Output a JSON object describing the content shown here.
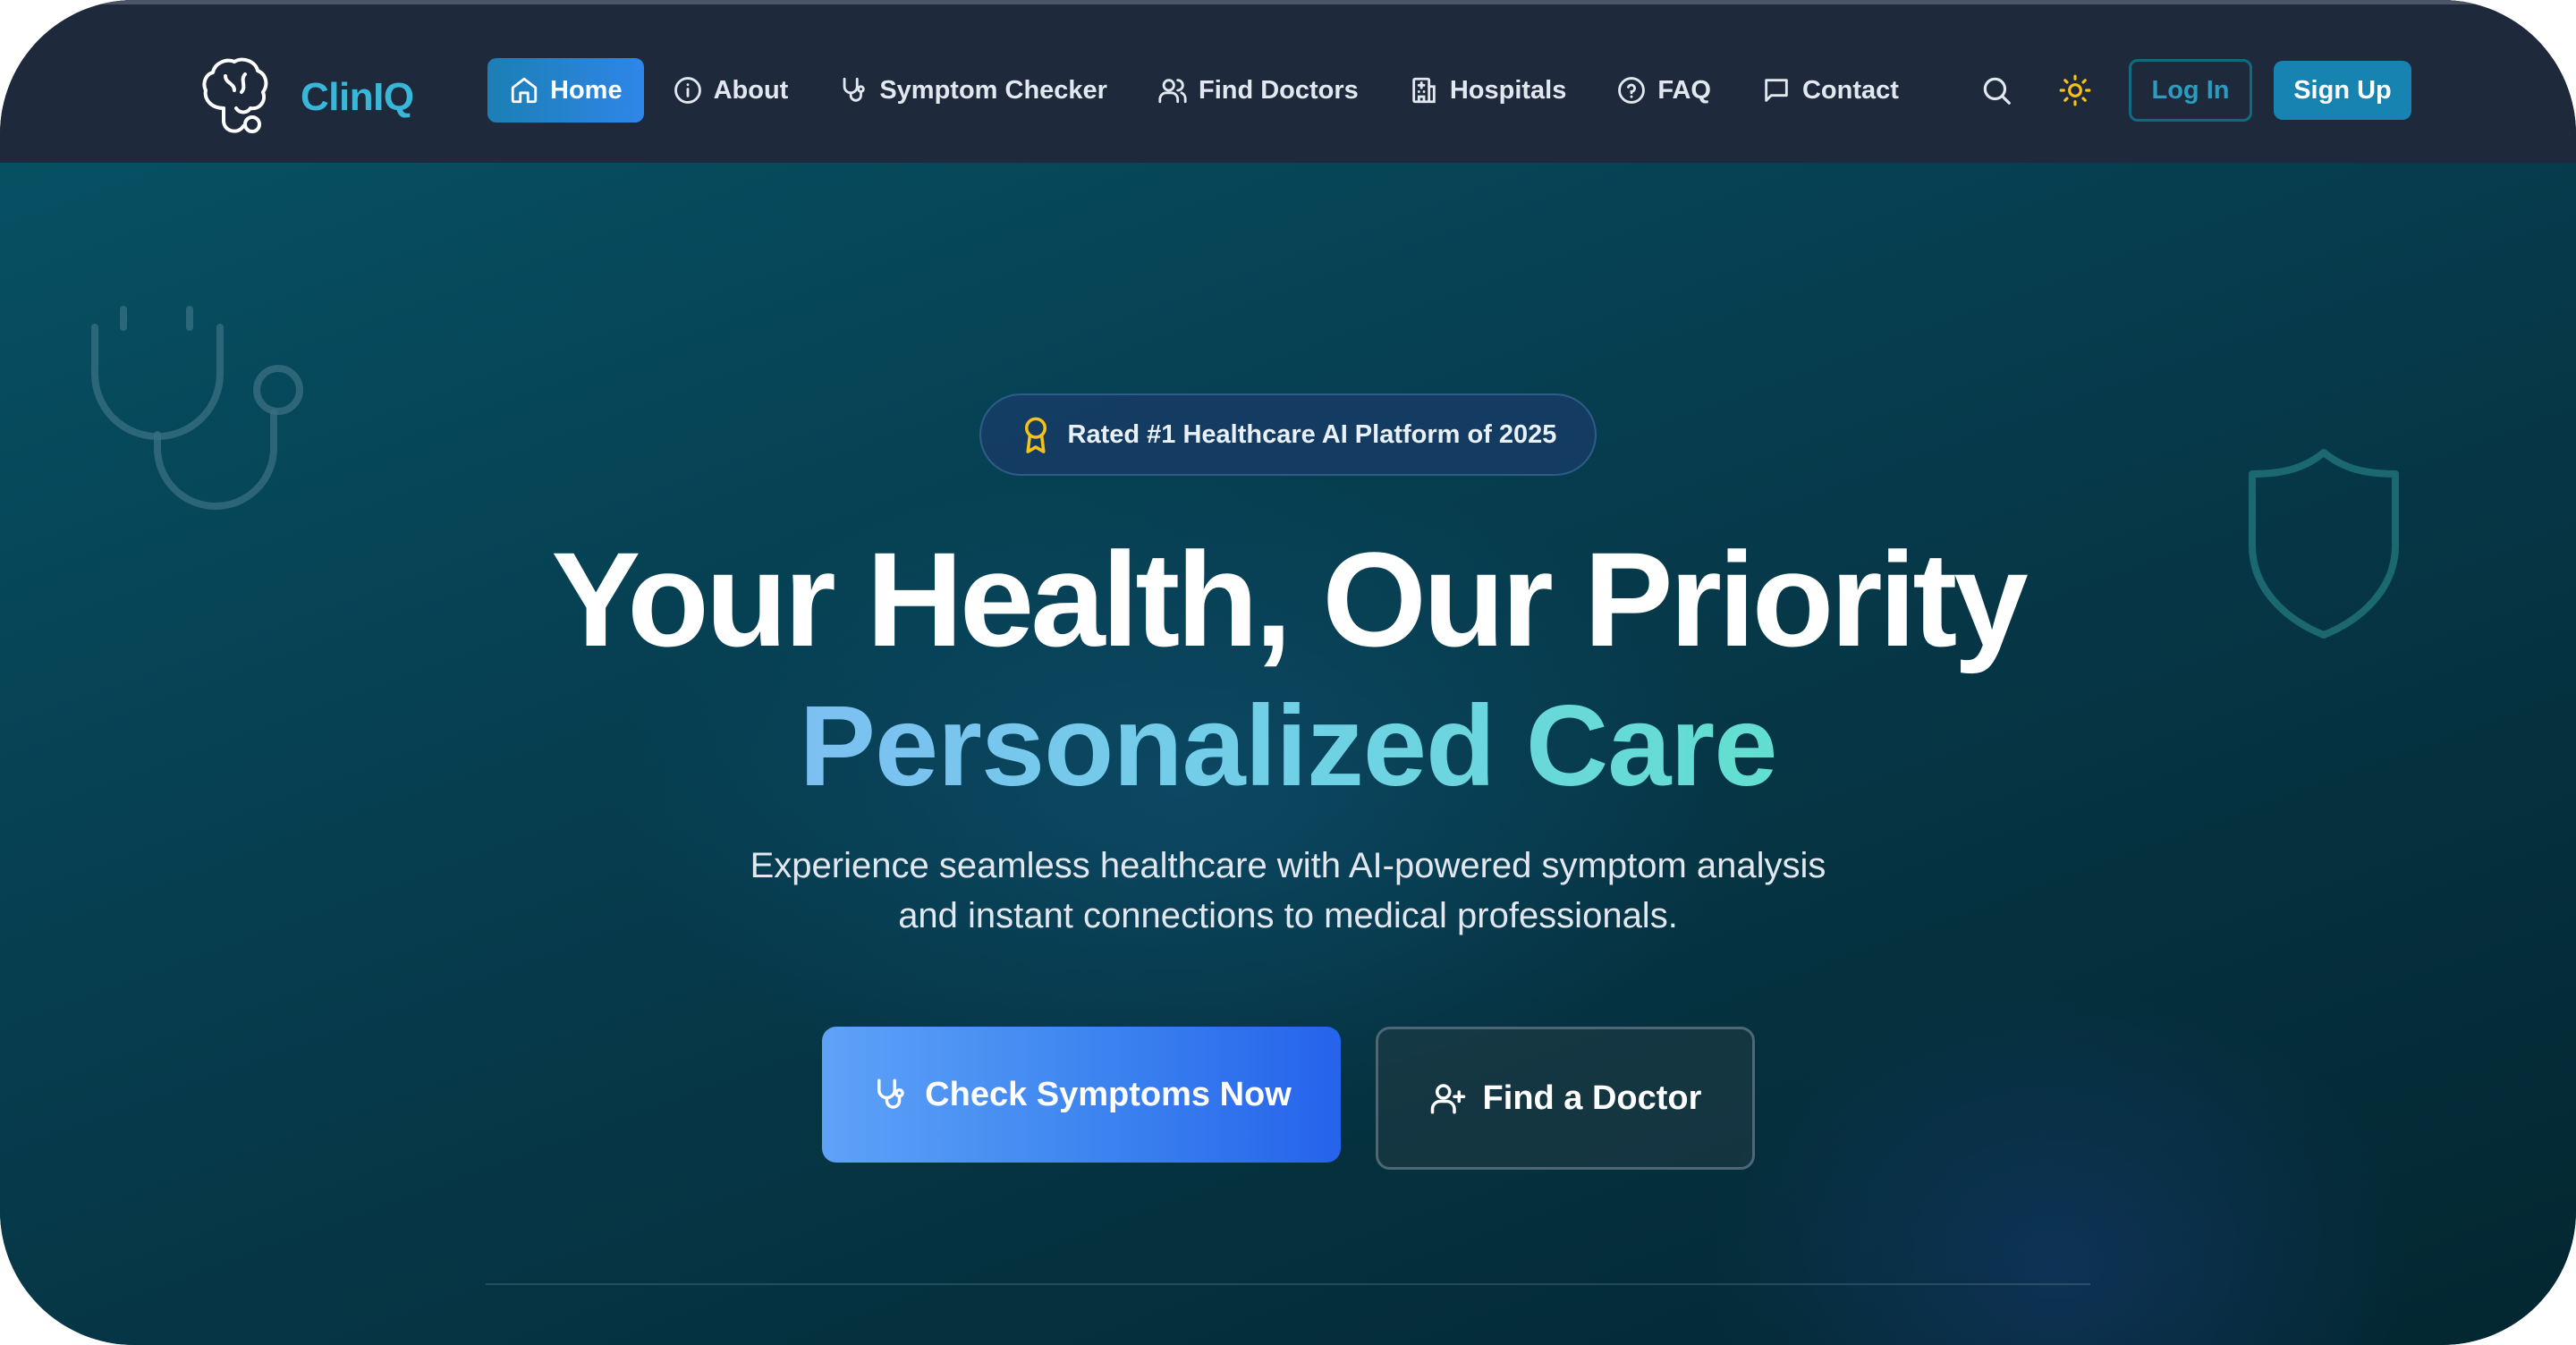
{
  "brand": {
    "name": "ClinIQ",
    "logo_icon": "brain-stethoscope-icon"
  },
  "nav": {
    "items": [
      {
        "label": "Home",
        "icon": "home-icon",
        "active": true
      },
      {
        "label": "About",
        "icon": "info-icon",
        "active": false
      },
      {
        "label": "Symptom Checker",
        "icon": "stethoscope-icon",
        "active": false
      },
      {
        "label": "Find Doctors",
        "icon": "users-icon",
        "active": false
      },
      {
        "label": "Hospitals",
        "icon": "hospital-icon",
        "active": false
      },
      {
        "label": "FAQ",
        "icon": "help-circle-icon",
        "active": false
      },
      {
        "label": "Contact",
        "icon": "message-icon",
        "active": false
      }
    ],
    "search_icon": "search-icon",
    "theme_icon": "sun-icon",
    "login_label": "Log In",
    "signup_label": "Sign Up"
  },
  "hero": {
    "badge": {
      "icon": "award-icon",
      "text": "Rated #1 Healthcare AI Platform of 2025"
    },
    "headline": "Your Health, Our Priority",
    "subheadline": "Personalized Care",
    "description_line1": "Experience seamless healthcare with AI-powered symptom analysis",
    "description_line2": "and instant connections to medical professionals.",
    "primary_cta": {
      "label": "Check Symptoms Now",
      "icon": "stethoscope-icon"
    },
    "secondary_cta": {
      "label": "Find a Doctor",
      "icon": "user-plus-icon"
    },
    "decorations": [
      "stethoscope-icon",
      "shield-icon"
    ]
  },
  "colors": {
    "navbar_bg": "#1e293b",
    "brand": "#38b7d8",
    "active_nav": "#2f86e8",
    "hero_bg": "#063d4f",
    "accent_gradient_start": "#7cc0f2",
    "accent_gradient_end": "#62dfcf",
    "primary_cta": "#3b82f6",
    "sun": "#f6c21a"
  }
}
